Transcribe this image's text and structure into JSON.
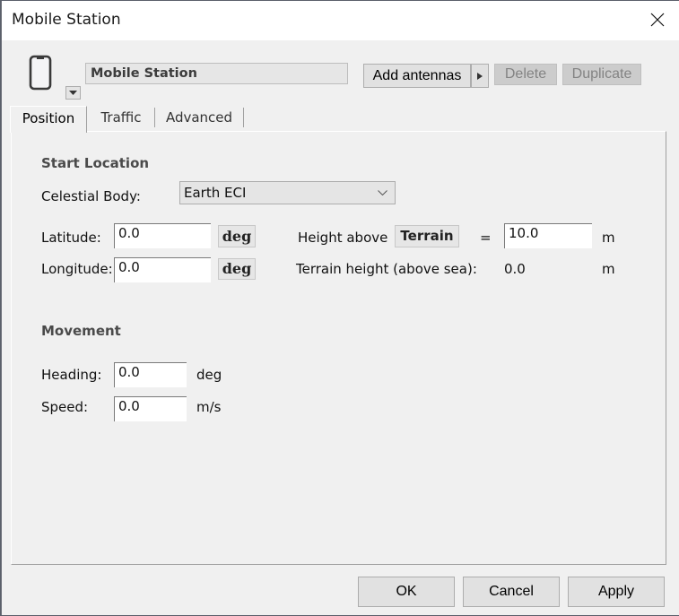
{
  "window": {
    "title": "Mobile Station",
    "close_icon": "close-icon"
  },
  "header": {
    "device_icon": "mobile-phone-icon",
    "icon_dropdown_icon": "triangle-down-icon",
    "name_value": "Mobile Station",
    "add_antennas_label": "Add antennas",
    "add_antennas_arrow_icon": "triangle-right-icon",
    "delete_label": "Delete",
    "duplicate_label": "Duplicate"
  },
  "tabs": [
    {
      "label": "Position",
      "active": true
    },
    {
      "label": "Traffic",
      "active": false
    },
    {
      "label": "Advanced",
      "active": false
    }
  ],
  "start_location": {
    "heading": "Start Location",
    "celestial_body_label": "Celestial Body:",
    "celestial_body_value": "Earth ECI",
    "latitude_label": "Latitude:",
    "latitude_value": "0.0",
    "latitude_unit": "deg",
    "longitude_label": "Longitude:",
    "longitude_value": "0.0",
    "longitude_unit": "deg",
    "height_above_label": "Height above",
    "height_reference": "Terrain",
    "equals": "=",
    "height_value": "10.0",
    "height_unit": "m",
    "terrain_height_label": "Terrain height (above sea):",
    "terrain_height_value": "0.0",
    "terrain_height_unit": "m"
  },
  "movement": {
    "heading": "Movement",
    "heading_label": "Heading:",
    "heading_value": "0.0",
    "heading_unit": "deg",
    "speed_label": "Speed:",
    "speed_value": "0.0",
    "speed_unit": "m/s"
  },
  "footer": {
    "ok_label": "OK",
    "cancel_label": "Cancel",
    "apply_label": "Apply"
  }
}
